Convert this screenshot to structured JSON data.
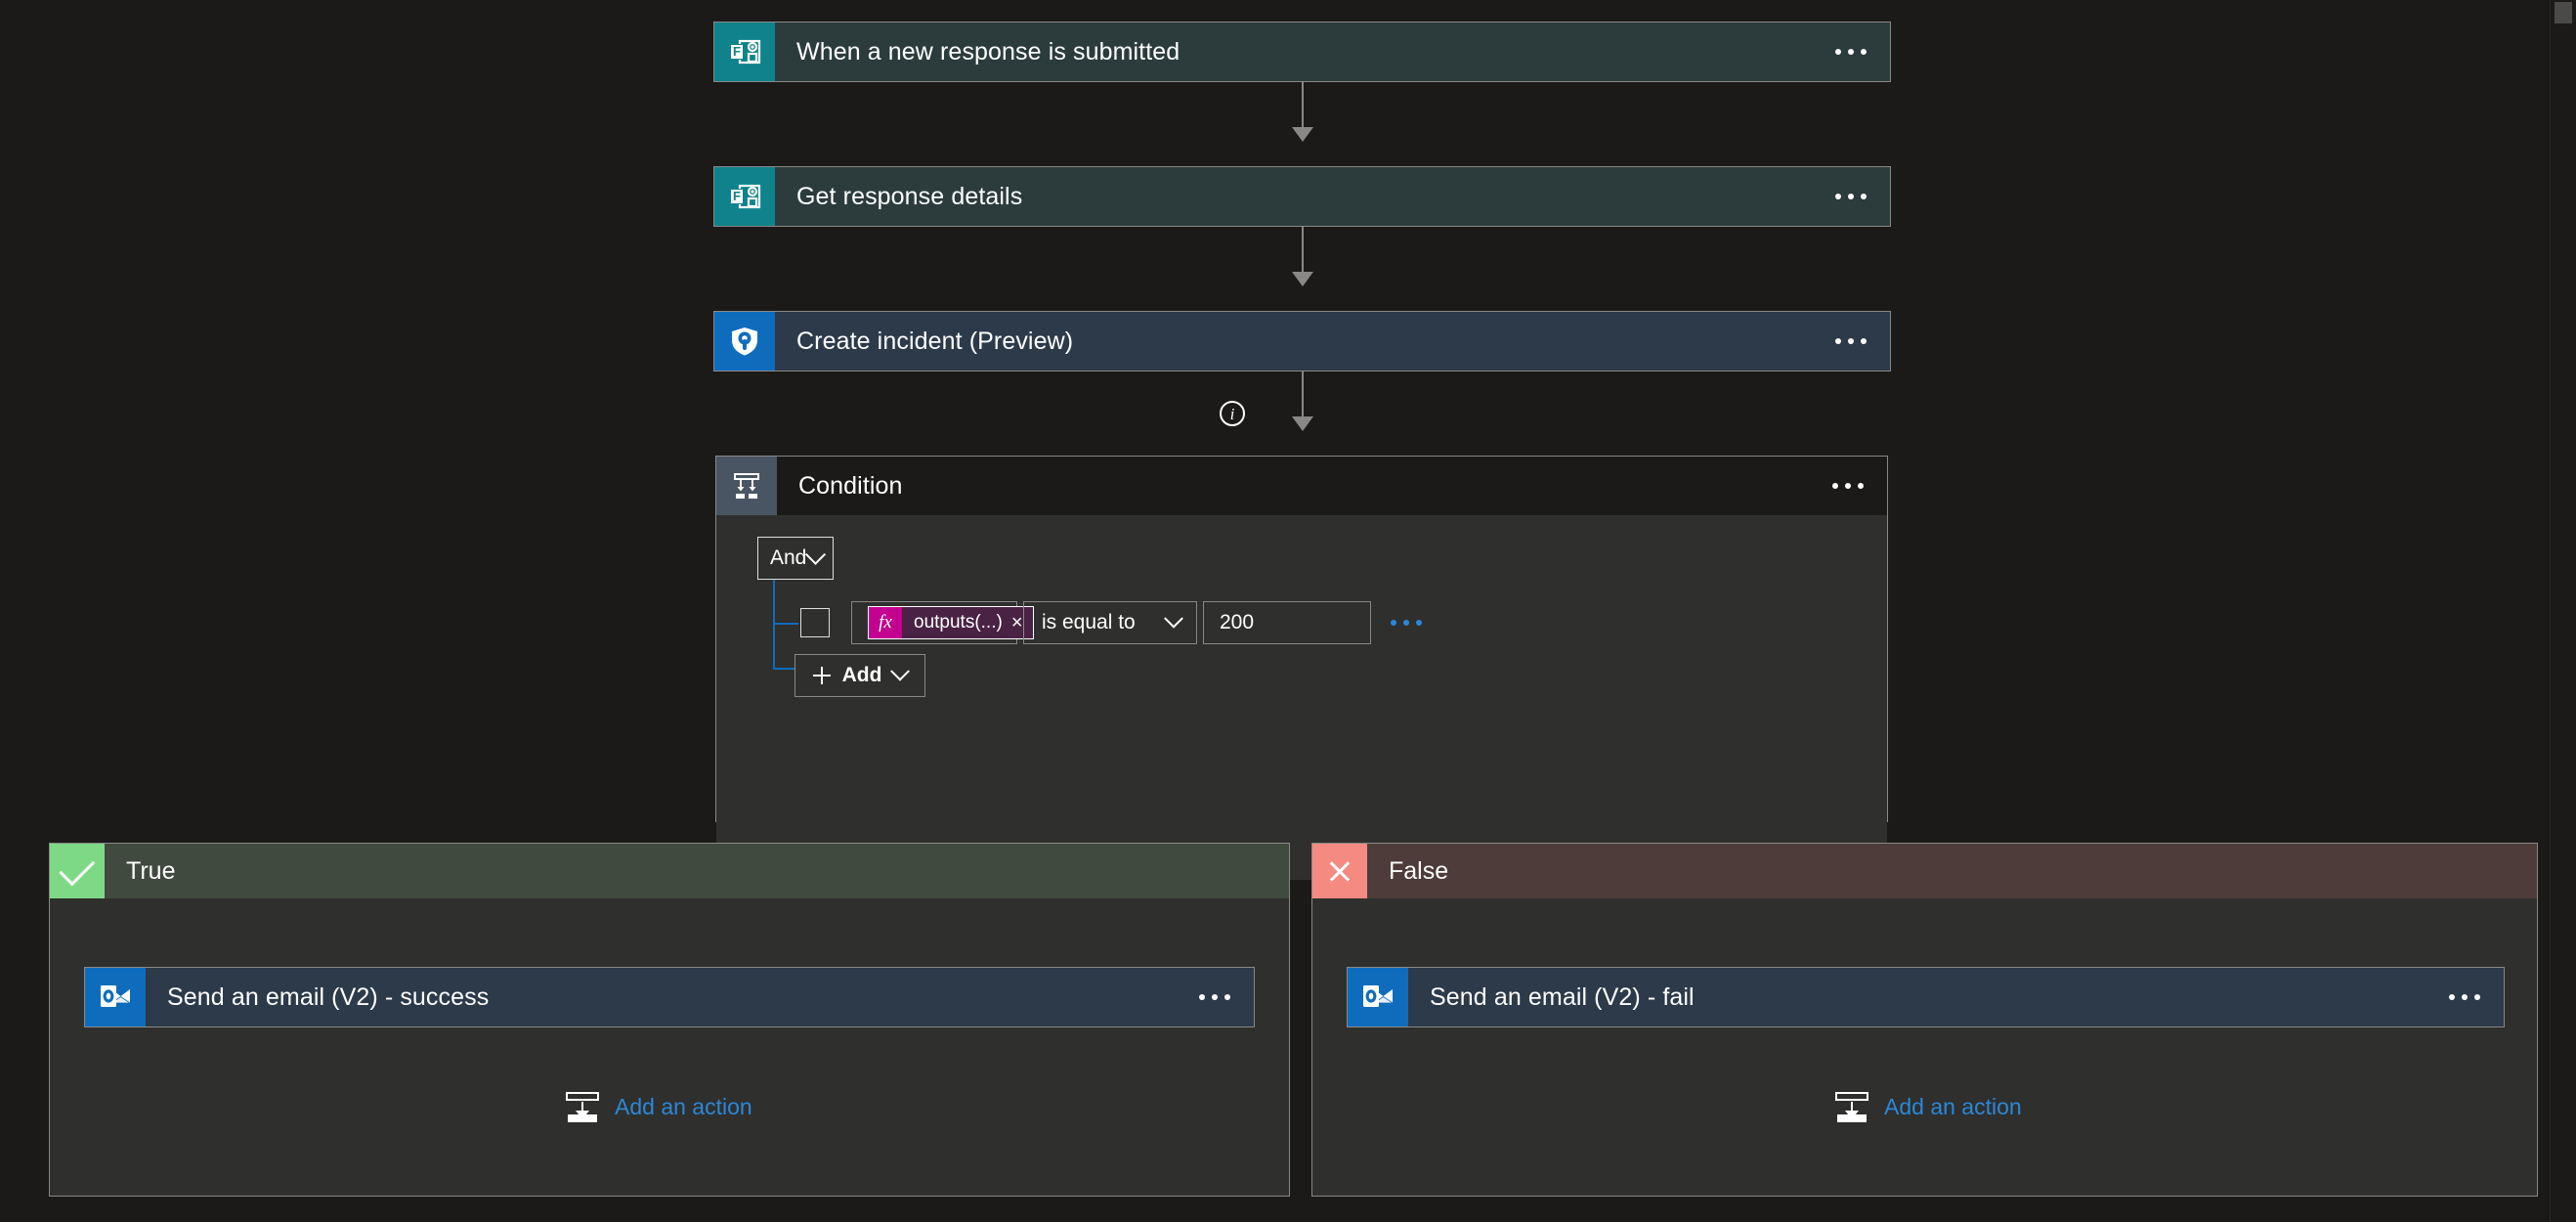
{
  "flow": {
    "steps": [
      {
        "id": "trigger",
        "title": "When a new response is submitted",
        "icon": "microsoft-forms-icon",
        "menu": "more-commands"
      },
      {
        "id": "get-response",
        "title": "Get response details",
        "icon": "microsoft-forms-icon",
        "menu": "more-commands"
      },
      {
        "id": "create-incident",
        "title": "Create incident (Preview)",
        "icon": "azure-sentinel-icon",
        "menu": "more-commands"
      }
    ],
    "info_badge": "i",
    "condition": {
      "title": "Condition",
      "icon": "condition-branch-icon",
      "logic_operator": "And",
      "rows": [
        {
          "token_label": "outputs(...)",
          "token_icon": "fx",
          "token_remove": "×",
          "operator": "is equal to",
          "value": "200"
        }
      ],
      "add_label": "Add"
    },
    "branches": [
      {
        "id": "true-branch",
        "label": "True",
        "badge_icon": "checkmark-icon",
        "badge_color": "#7ed987",
        "header_color": "#404a3e",
        "action": {
          "title": "Send an email (V2) - success",
          "icon": "outlook-icon"
        },
        "add_action_label": "Add an action"
      },
      {
        "id": "false-branch",
        "label": "False",
        "badge_icon": "close-icon",
        "badge_color": "#f58a82",
        "header_color": "#4d3c39",
        "action": {
          "title": "Send an email (V2) - fail",
          "icon": "outlook-icon"
        },
        "add_action_label": "Add an action"
      }
    ]
  },
  "colors": {
    "canvas_background": "#1b1a19",
    "forms_teal": "#10828b",
    "sentinel_blue": "#0f6cbd",
    "link_blue": "#2b88d8",
    "token_magenta": "#c3008f",
    "true_green": "#7ed987",
    "false_red": "#f58a82"
  }
}
